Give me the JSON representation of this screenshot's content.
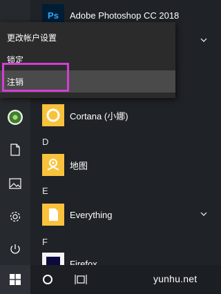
{
  "context_menu": {
    "items": [
      {
        "label": "更改帐户设置"
      },
      {
        "label": "锁定"
      },
      {
        "label": "注销"
      }
    ],
    "active_index": 2,
    "highlight_color": "#d23fd6"
  },
  "apps": [
    {
      "name": "Adobe Photoshop CC 2018",
      "tile_text": "Ps",
      "expandable": false
    },
    {
      "name": "Cortana (小娜)",
      "expandable": false
    },
    {
      "name": "地图",
      "expandable": false
    },
    {
      "name": "Everything",
      "expandable": true
    },
    {
      "name": "Firefox",
      "expandable": false
    }
  ],
  "section_letters": [
    "D",
    "E",
    "F"
  ],
  "rail": [
    "avatar",
    "document-icon",
    "picture-icon",
    "gear-icon",
    "power-icon"
  ],
  "taskbar": {
    "icons": [
      "windows-logo-icon",
      "cortana-circle-icon",
      "task-view-icon"
    ]
  },
  "watermark": "yunhu.net",
  "colors": {
    "start_bg": "#1f2226",
    "menu_bg": "#2b2b2b",
    "menu_active": "#4a4a4a",
    "accent_yellow": "#f9c23c",
    "photoshop_blue": "#001d34"
  }
}
